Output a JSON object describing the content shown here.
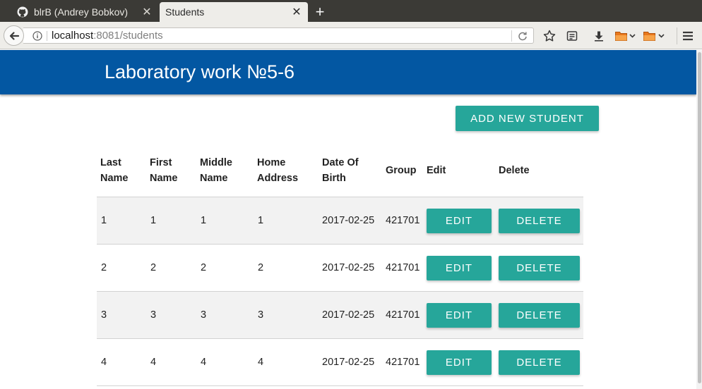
{
  "browser": {
    "tabs": [
      {
        "title": "blrB (Andrey Bobkov)",
        "icon": "github-icon",
        "active": false
      },
      {
        "title": "Students",
        "active": true
      }
    ],
    "tab_close": "✕",
    "new_tab": "+",
    "url_host": "localhost",
    "url_rest": ":8081/students"
  },
  "app": {
    "title": "Laboratory work №5-6",
    "accent_color": "#0357a2",
    "button_color": "#26a69a"
  },
  "actions": {
    "add_label": "ADD NEW STUDENT"
  },
  "table": {
    "headers": {
      "last_name": [
        "Last",
        "Name"
      ],
      "first_name": [
        "First",
        "Name"
      ],
      "middle_name": [
        "Middle",
        "Name"
      ],
      "home_address": [
        "Home",
        "Address"
      ],
      "date_of_birth": [
        "Date Of",
        "Birth"
      ],
      "group": "Group",
      "edit": "Edit",
      "delete": "Delete"
    },
    "rows": [
      {
        "last_name": "1",
        "first_name": "1",
        "middle_name": "1",
        "home_address": "1",
        "date_of_birth": "2017-02-25",
        "group": "421701",
        "edit": "EDIT",
        "delete": "DELETE"
      },
      {
        "last_name": "2",
        "first_name": "2",
        "middle_name": "2",
        "home_address": "2",
        "date_of_birth": "2017-02-25",
        "group": "421701",
        "edit": "EDIT",
        "delete": "DELETE"
      },
      {
        "last_name": "3",
        "first_name": "3",
        "middle_name": "3",
        "home_address": "3",
        "date_of_birth": "2017-02-25",
        "group": "421701",
        "edit": "EDIT",
        "delete": "DELETE"
      },
      {
        "last_name": "4",
        "first_name": "4",
        "middle_name": "4",
        "home_address": "4",
        "date_of_birth": "2017-02-25",
        "group": "421701",
        "edit": "EDIT",
        "delete": "DELETE"
      }
    ]
  }
}
